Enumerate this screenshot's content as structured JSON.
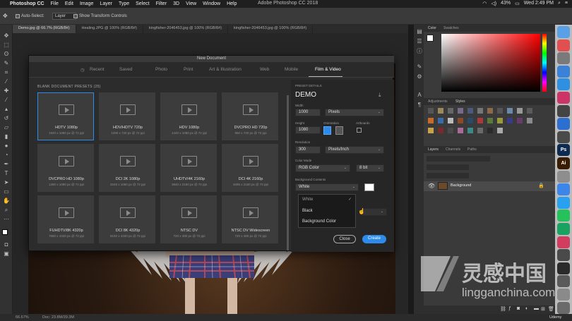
{
  "menubar": {
    "apple": "",
    "app": "Photoshop CC",
    "menus": [
      "File",
      "Edit",
      "Image",
      "Layer",
      "Type",
      "Select",
      "Filter",
      "3D",
      "View",
      "Window",
      "Help"
    ],
    "window_title": "Adobe Photoshop CC 2018",
    "battery": "43%",
    "clock": "Wed 2:49 PM"
  },
  "options_bar": {
    "auto_select_label": "Auto-Select:",
    "auto_select_value": "Layer",
    "transform_label": "Show Transform Controls"
  },
  "doc_tabs": [
    {
      "label": "Demo.jpg @ 66.7% (RGB/8#)",
      "active": true
    },
    {
      "label": "Healing.JPG @ 100% (RGB/8#)"
    },
    {
      "label": "kingfisher-2046453.jpg @ 100% (RGB/8#)"
    },
    {
      "label": "kingfisher-2046453.jpg @ 100% (RGB/8#)"
    }
  ],
  "status": {
    "zoom": "66.67%",
    "doc": "Doc: 23.8M/39.3M"
  },
  "dialog": {
    "title": "New Document",
    "tabs": [
      "Recent",
      "Saved",
      "Photo",
      "Print",
      "Art & Illustration",
      "Web",
      "Mobile",
      "Film & Video"
    ],
    "active_tab": "Film & Video",
    "presets_heading": "BLANK DOCUMENT PRESETS",
    "presets_count": "(25)",
    "presets": [
      {
        "name": "HDTV 1080p",
        "size": "1920 x 1080 px @ 72 ppi"
      },
      {
        "name": "HDV/HDTV 720p",
        "size": "1280 x 720 px @ 72 ppi"
      },
      {
        "name": "HDV 1080p",
        "size": "1440 x 1080 px @ 72 ppi"
      },
      {
        "name": "DVCPRO HD 720p",
        "size": "960 x 720 px @ 72 ppi"
      },
      {
        "name": "DVCPRO HD 1080p",
        "size": "1280 x 1080 px @ 72 ppi"
      },
      {
        "name": "DCI 2K 1080p",
        "size": "2048 x 1080 px @ 72 ppi"
      },
      {
        "name": "UHDTV/4K 2160p",
        "size": "3840 x 2160 px @ 72 ppi"
      },
      {
        "name": "DCI 4K 2160p",
        "size": "4096 x 2160 px @ 72 ppi"
      },
      {
        "name": "FUHDTV/8K 4320p",
        "size": "7680 x 4320 px @ 72 ppi"
      },
      {
        "name": "DCI 8K 4320p",
        "size": "8192 x 4320 px @ 72 ppi"
      },
      {
        "name": "NTSC DV",
        "size": "720 x 480 px @ 72 ppi"
      },
      {
        "name": "NTSC DV Widescreen",
        "size": "720 x 480 px @ 72 ppi"
      }
    ],
    "details": {
      "heading": "PRESET DETAILS",
      "name": "DEMO",
      "width_label": "Width",
      "width_value": "1000",
      "width_unit": "Pixels",
      "height_label": "Height",
      "height_value": "1080",
      "orientation_label": "Orientation",
      "artboards_label": "Artboards",
      "resolution_label": "Resolution",
      "resolution_value": "300",
      "resolution_unit": "Pixels/Inch",
      "color_mode_label": "Color Mode",
      "color_mode_value": "RGB Color",
      "bit_depth": "8 bit",
      "bg_label": "Background Contents",
      "bg_value": "White",
      "dropdown": [
        "White",
        "Black",
        "Background Color"
      ]
    },
    "close_label": "Close",
    "create_label": "Create"
  },
  "panels": {
    "color_tabs": [
      "Color",
      "Swatches"
    ],
    "adjust_tabs": [
      "Adjustments",
      "Styles"
    ],
    "layers_tabs": [
      "Layers",
      "Channels",
      "Paths"
    ],
    "layer_name": "Background"
  },
  "dock": [
    {
      "label": "",
      "color": "#5aa0e6"
    },
    {
      "label": "",
      "color": "#e05050"
    },
    {
      "label": "",
      "color": "#7a7a7a"
    },
    {
      "label": "",
      "color": "#3a82d8"
    },
    {
      "label": "",
      "color": "#2f8fe0"
    },
    {
      "label": "",
      "color": "#cc3366"
    },
    {
      "label": "",
      "color": "#444444"
    },
    {
      "label": "",
      "color": "#2c6fd1"
    },
    {
      "label": "",
      "color": "#4a4a4a"
    },
    {
      "label": "Ps",
      "color": "#0c2a52"
    },
    {
      "label": "Ai",
      "color": "#3a1c00"
    },
    {
      "label": "",
      "color": "#8e8e8e"
    },
    {
      "label": "",
      "color": "#3b86e8"
    },
    {
      "label": "",
      "color": "#2aa0f0"
    },
    {
      "label": "",
      "color": "#25c15a"
    },
    {
      "label": "",
      "color": "#1aa260"
    },
    {
      "label": "",
      "color": "#d23d5f"
    },
    {
      "label": "",
      "color": "#4a4a4a"
    },
    {
      "label": "",
      "color": "#2b2b2b"
    },
    {
      "label": "",
      "color": "#5a5a5a"
    },
    {
      "label": "",
      "color": "#8a8a8a"
    },
    {
      "label": "",
      "color": "#6a6a6a"
    }
  ],
  "dock_bottom_label": "Udemy",
  "watermark": {
    "brand": "灵感中国",
    "url": "lingganchina.com"
  }
}
